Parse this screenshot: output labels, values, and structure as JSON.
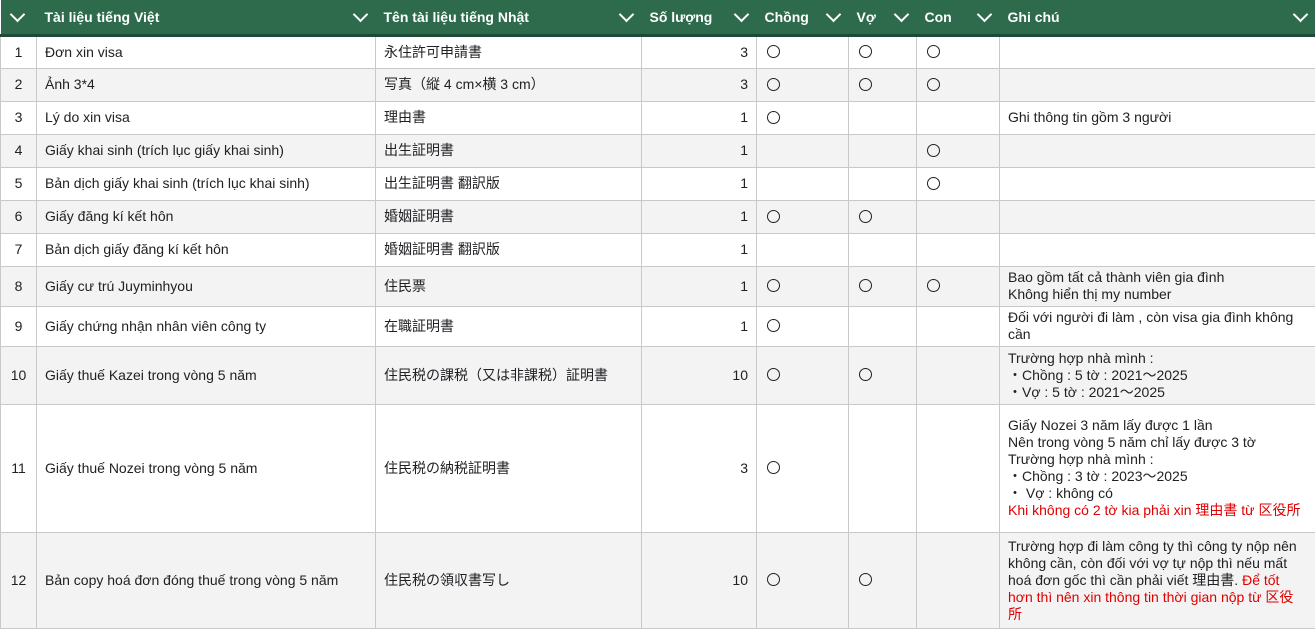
{
  "headers": {
    "vn_doc": "Tài liệu tiếng Việt",
    "jp_doc": "Tên tài liệu tiếng Nhật",
    "quantity": "Số lượng",
    "husband": "Chồng",
    "wife": "Vợ",
    "child": "Con",
    "note": "Ghi chú"
  },
  "colors": {
    "header_bg": "#2e6a4c",
    "red_note": "#e00000"
  },
  "rows": [
    {
      "no": "1",
      "vn": "Đơn xin visa",
      "jp": "永住許可申請書",
      "qty": "3",
      "husband": true,
      "wife": true,
      "child": true,
      "notes": []
    },
    {
      "no": "2",
      "vn": "Ảnh 3*4",
      "jp": "写真（縦 4 cm×横 3 cm）",
      "qty": "3",
      "husband": true,
      "wife": true,
      "child": true,
      "notes": []
    },
    {
      "no": "3",
      "vn": "Lý do xin visa",
      "jp": "理由書",
      "qty": "1",
      "husband": true,
      "wife": false,
      "child": false,
      "notes": [
        {
          "text": "Ghi thông tin gồm 3 người",
          "red": false
        }
      ]
    },
    {
      "no": "4",
      "vn": "Giấy khai sinh (trích lục giấy khai sinh)",
      "jp": "出生証明書",
      "qty": "1",
      "husband": false,
      "wife": false,
      "child": true,
      "notes": []
    },
    {
      "no": "5",
      "vn": "Bản dịch giấy khai sinh (trích lục khai sinh)",
      "jp": "出生証明書 翻訳版",
      "qty": "1",
      "husband": false,
      "wife": false,
      "child": true,
      "notes": []
    },
    {
      "no": "6",
      "vn": "Giấy đăng kí kết hôn",
      "jp": "婚姻証明書",
      "qty": "1",
      "husband": true,
      "wife": true,
      "child": false,
      "notes": []
    },
    {
      "no": "7",
      "vn": "Bản dịch giấy đăng kí kết hôn",
      "jp": "婚姻証明書 翻訳版",
      "qty": "1",
      "husband": false,
      "wife": false,
      "child": false,
      "notes": []
    },
    {
      "no": "8",
      "vn": "Giấy cư trú Juyminhyou",
      "jp": "住民票",
      "qty": "1",
      "husband": true,
      "wife": true,
      "child": true,
      "notes": [
        {
          "text": "Bao gồm tất cả thành viên gia đình",
          "red": false
        },
        {
          "text": "Không hiển thị my number",
          "red": false
        }
      ]
    },
    {
      "no": "9",
      "vn": "Giấy chứng nhận nhân viên công ty",
      "jp": "在職証明書",
      "qty": "1",
      "husband": true,
      "wife": false,
      "child": false,
      "notes": [
        {
          "text": "Đối với người đi làm , còn visa gia đình không cần",
          "red": false
        }
      ]
    },
    {
      "no": "10",
      "vn": "Giấy thuế Kazei trong vòng 5 năm",
      "jp": "住民税の課税（又は非課税）証明書",
      "qty": "10",
      "husband": true,
      "wife": true,
      "child": false,
      "notes": [
        {
          "text": "Trường hợp nhà mình :",
          "red": false
        },
        {
          "text": "・Chồng : 5 tờ : 2021～2025",
          "red": false
        },
        {
          "text": "・Vợ : 5 tờ : 2021～2025",
          "red": false
        }
      ]
    },
    {
      "no": "11",
      "vn": "Giấy thuế Nozei trong vòng 5 năm",
      "jp": "住民税の納税証明書",
      "qty": "3",
      "husband": true,
      "wife": false,
      "child": false,
      "notes": [
        {
          "text": "Giấy Nozei 3 năm lấy được 1 lần",
          "red": false
        },
        {
          "text": "Nên trong vòng 5 năm chỉ lấy được 3 tờ",
          "red": false
        },
        {
          "text": "Trường hợp nhà mình :",
          "red": false
        },
        {
          "text": "・Chồng : 3 tờ : 2023～2025",
          "red": false
        },
        {
          "text": "・ Vợ : không có",
          "red": false
        },
        {
          "text": "Khi không có 2 tờ kia phải xin 理由書 từ 区役所",
          "red": true
        }
      ]
    },
    {
      "no": "12",
      "vn": "Bản copy hoá đơn đóng thuế trong vòng 5 năm",
      "jp": "住民税の領収書写し",
      "qty": "10",
      "husband": true,
      "wife": true,
      "child": false,
      "notes": [
        {
          "text": "Trường hợp đi làm công ty thì công ty nộp nên không cần, còn đối với vợ tự nộp thì nếu mất hoá đơn gốc thì cần phải viết 理由書.",
          "red": false
        },
        {
          "text": " Để tốt hơn thì nên xin thông tin thời gian nộp từ 区役所",
          "red": true
        }
      ]
    }
  ]
}
